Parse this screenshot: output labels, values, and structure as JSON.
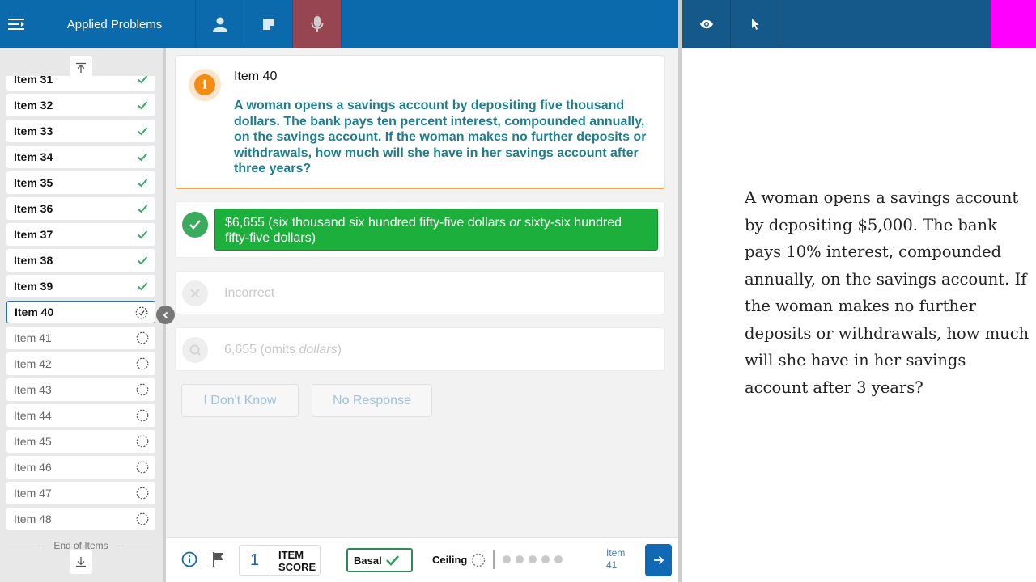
{
  "header": {
    "title": "Applied Problems"
  },
  "sidebar": {
    "items": [
      {
        "label": "Item 31",
        "state": "done"
      },
      {
        "label": "Item 32",
        "state": "done"
      },
      {
        "label": "Item 33",
        "state": "done"
      },
      {
        "label": "Item 34",
        "state": "done"
      },
      {
        "label": "Item 35",
        "state": "done"
      },
      {
        "label": "Item 36",
        "state": "done"
      },
      {
        "label": "Item 37",
        "state": "done"
      },
      {
        "label": "Item 38",
        "state": "done"
      },
      {
        "label": "Item 39",
        "state": "done"
      },
      {
        "label": "Item 40",
        "state": "current"
      },
      {
        "label": "Item 41",
        "state": "todo"
      },
      {
        "label": "Item 42",
        "state": "todo"
      },
      {
        "label": "Item 43",
        "state": "todo"
      },
      {
        "label": "Item 44",
        "state": "todo"
      },
      {
        "label": "Item 45",
        "state": "todo"
      },
      {
        "label": "Item 46",
        "state": "todo"
      },
      {
        "label": "Item 47",
        "state": "todo"
      },
      {
        "label": "Item 48",
        "state": "todo"
      }
    ],
    "end_label": "End of Items"
  },
  "question": {
    "title": "Item 40",
    "text": "A woman opens a savings account by depositing five thousand dollars. The bank pays ten percent interest, compounded annually, on the savings account. If the woman makes no further deposits or withdrawals, how much will she have in her savings account after three years?"
  },
  "answers": {
    "correct_pre": "$6,655 (six thousand six hundred fifty-five dollars ",
    "correct_or": "or",
    "correct_post": " sixty-six hundred fifty-five dollars)",
    "incorrect": "Incorrect",
    "query_pre": "6,655 (omits ",
    "query_em": "dollars",
    "query_post": ")"
  },
  "buttons": {
    "dont_know": "I Don't Know",
    "no_response": "No Response"
  },
  "bottom": {
    "score": "1",
    "score_line1": "ITEM",
    "score_line2": "SCORE",
    "basal": "Basal",
    "ceiling": "Ceiling",
    "next_line1": "Item",
    "next_line2": "41"
  },
  "examinee": {
    "text": "A woman opens a savings account by depositing $5,000. The bank pays 10% interest, compounded annually, on the savings account. If the woman makes no further deposits or withdrawals, how much will she have in her savings account after 3 years?"
  },
  "colors": {
    "topbar": "#0a6aab",
    "topbar_right": "#14598a",
    "active_tool": "#974651",
    "correct_green": "#1daf3c",
    "question_teal": "#1e7c8c",
    "info_orange": "#f38b14",
    "marker": "#ff00ff"
  }
}
